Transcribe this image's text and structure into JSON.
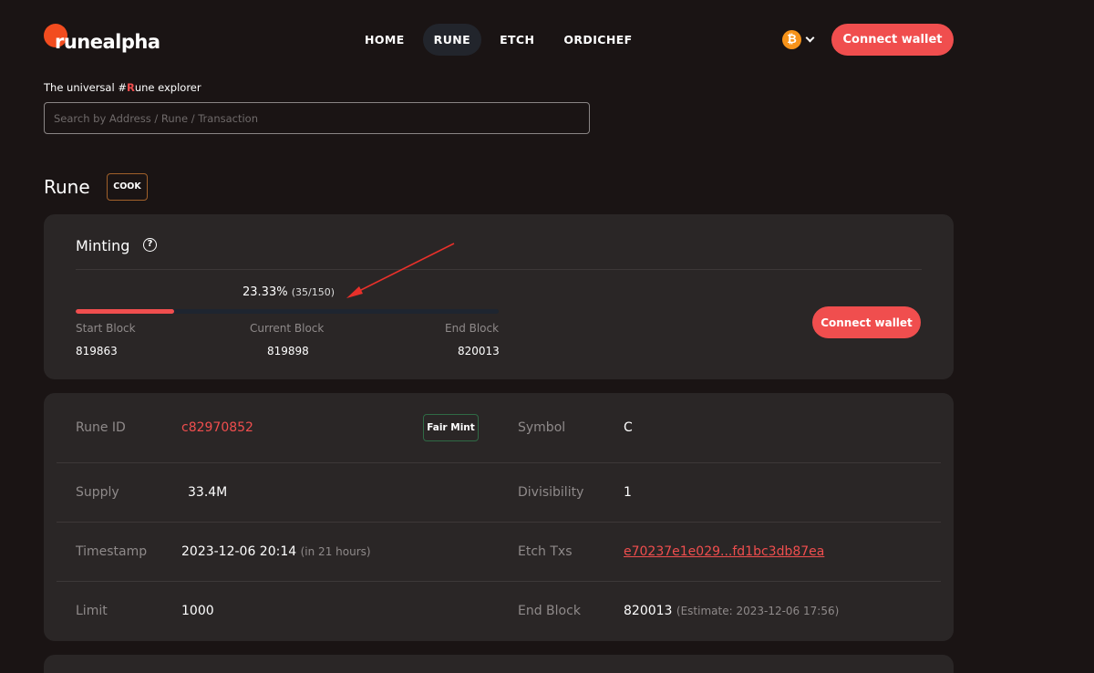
{
  "header": {
    "logo_text": "runealpha",
    "nav": [
      {
        "label": "HOME",
        "active": false
      },
      {
        "label": "RUNE",
        "active": true
      },
      {
        "label": "ETCH",
        "active": false
      },
      {
        "label": "ORDICHEF",
        "active": false
      }
    ],
    "btc_symbol": "₿",
    "connect_label": "Connect wallet"
  },
  "tagline": {
    "prefix": "The universal #",
    "accent": "R",
    "suffix": "une explorer"
  },
  "search": {
    "placeholder": "Search by Address / Rune / Transaction",
    "value": ""
  },
  "rune": {
    "title": "Rune",
    "badge": "COOK"
  },
  "minting": {
    "title": "Minting",
    "help_icon": "?",
    "percent": "23.33%",
    "count": "(35/150)",
    "progress_fraction": 0.2333,
    "start_label": "Start Block",
    "start_value": "819863",
    "current_label": "Current Block",
    "current_value": "819898",
    "end_label": "End Block",
    "end_value": "820013",
    "connect_label": "Connect wallet"
  },
  "info": {
    "rune_id_label": "Rune ID",
    "rune_id_value": "c82970852",
    "fair_badge": "Fair Mint",
    "symbol_label": "Symbol",
    "symbol_value": "C",
    "supply_label": "Supply",
    "supply_value": "33.4M",
    "divisibility_label": "Divisibility",
    "divisibility_value": "1",
    "timestamp_label": "Timestamp",
    "timestamp_value": "2023-12-06 20:14",
    "timestamp_note": "(in 21 hours)",
    "etch_label": "Etch Txs",
    "etch_value": "e70237e1e029...fd1bc3db87ea",
    "limit_label": "Limit",
    "limit_value": "1000",
    "endblock_label": "End Block",
    "endblock_value": "820013",
    "endblock_note": "(Estimate: 2023-12-06 17:56)"
  },
  "colors": {
    "accent": "#f04e4e",
    "background": "#1a1414",
    "card": "#2a2626",
    "btc": "#f7931a"
  }
}
